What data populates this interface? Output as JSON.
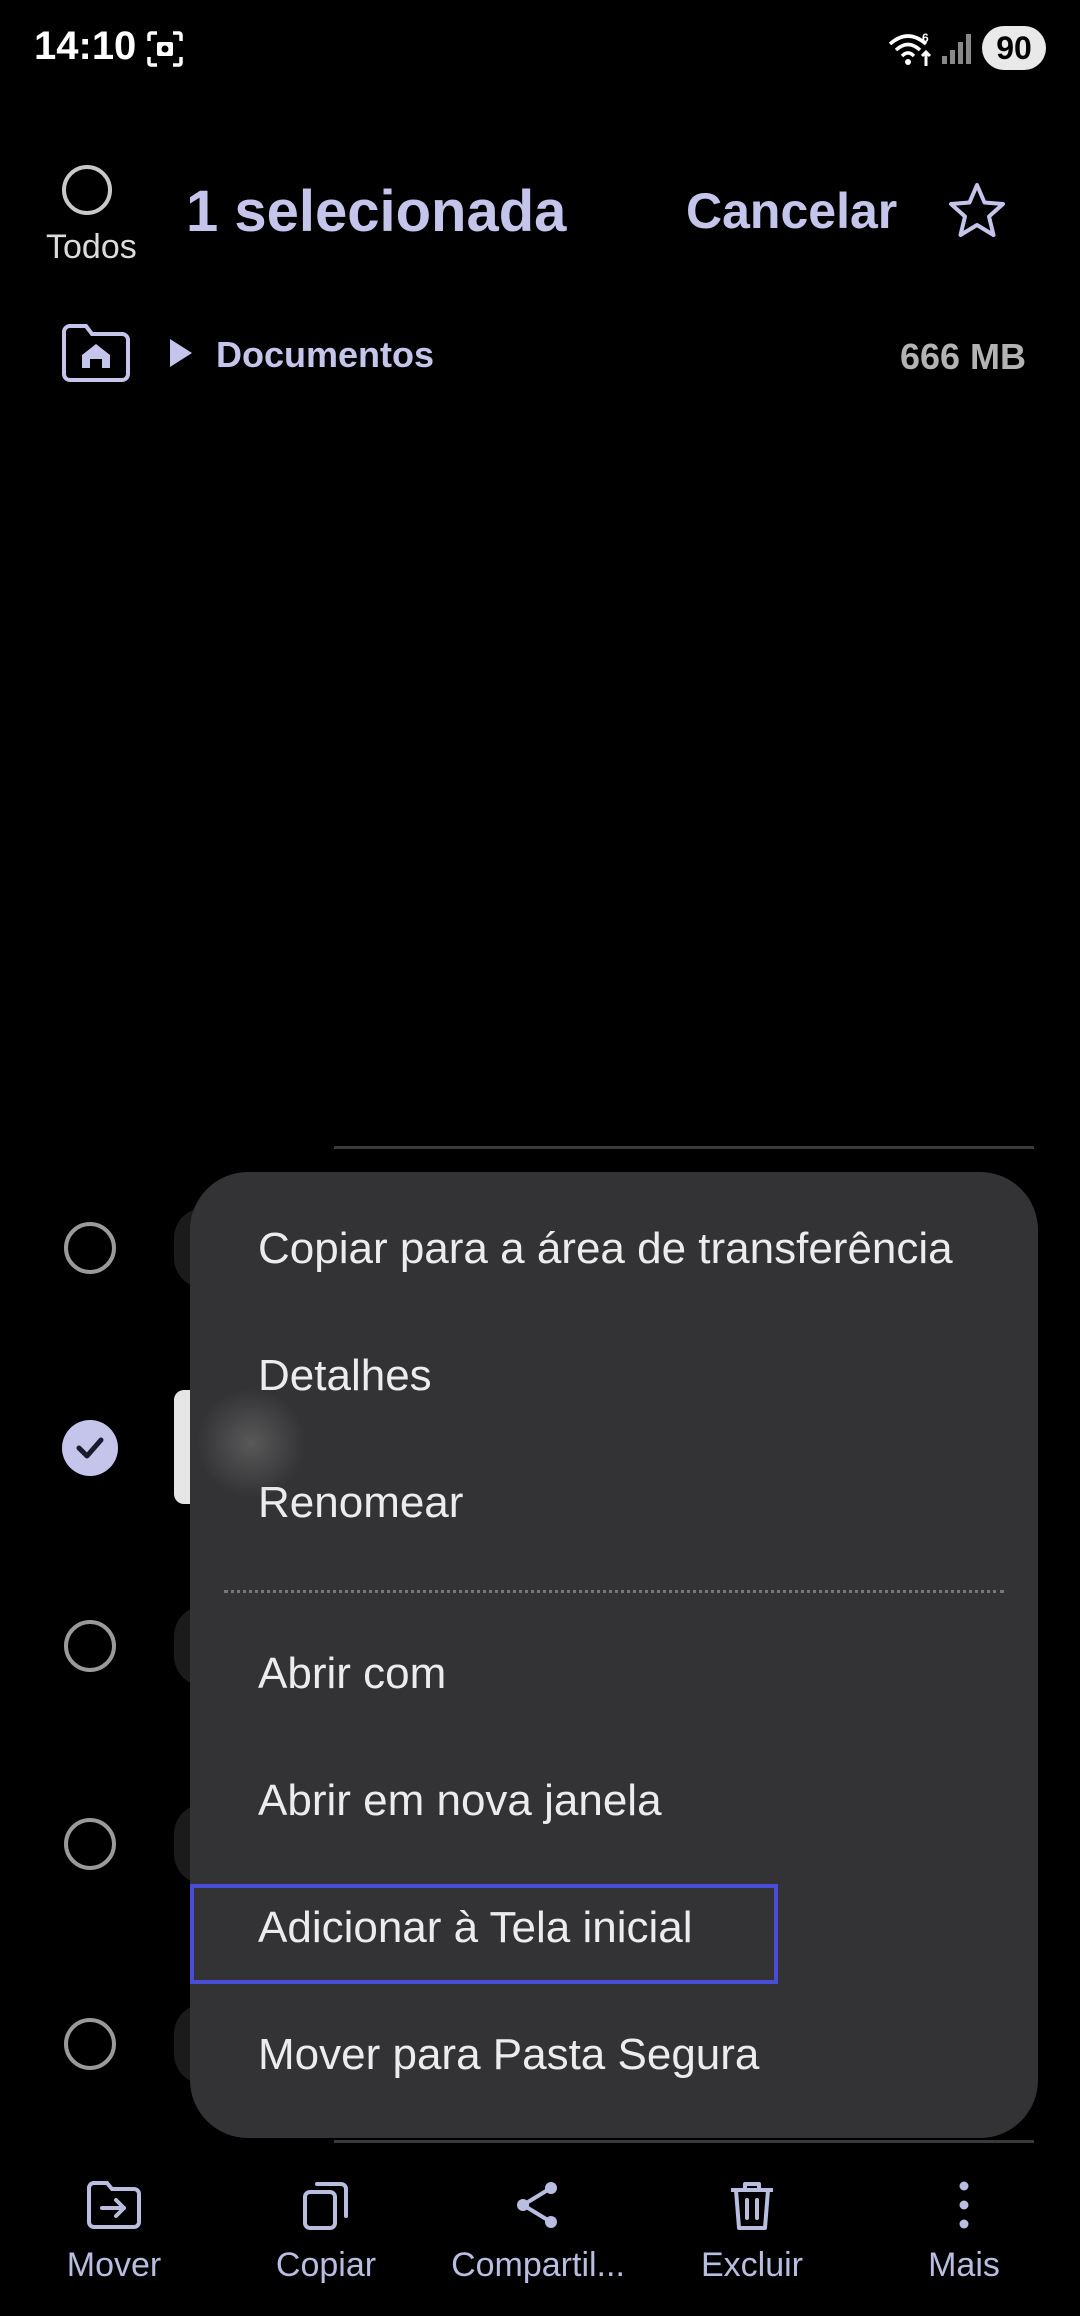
{
  "status_bar": {
    "time": "14:10",
    "battery": "90",
    "icons": [
      "screenshot-icon",
      "wifi-icon",
      "signal-icon"
    ]
  },
  "header": {
    "select_all_label": "Todos",
    "title": "1 selecionada",
    "cancel_label": "Cancelar",
    "favorite_icon": "star-icon"
  },
  "breadcrumb": {
    "home_icon": "home-icon",
    "folder": "Documentos",
    "size": "666 MB"
  },
  "list": {
    "rows": [
      {
        "selected": false
      },
      {
        "selected": true
      },
      {
        "selected": false
      },
      {
        "selected": false
      },
      {
        "selected": false
      }
    ]
  },
  "menu": {
    "items": [
      {
        "label": "Copiar para a área de transferência"
      },
      {
        "label": "Detalhes"
      },
      {
        "label": "Renomear"
      },
      {
        "label": "Abrir com"
      },
      {
        "label": "Abrir em nova janela"
      },
      {
        "label": "Adicionar à Tela inicial"
      },
      {
        "label": "Mover para Pasta Segura"
      }
    ],
    "highlighted": "Adicionar à Tela inicial"
  },
  "toolbar": {
    "items": [
      {
        "label": "Mover",
        "icon": "move-icon"
      },
      {
        "label": "Copiar",
        "icon": "copy-icon"
      },
      {
        "label": "Compartil...",
        "icon": "share-icon"
      },
      {
        "label": "Excluir",
        "icon": "trash-icon"
      },
      {
        "label": "Mais",
        "icon": "more-vertical-icon"
      }
    ]
  },
  "colors": {
    "accent": "#c5c5ec",
    "menu_background": "#333335",
    "highlight_border": "#4a4dd8"
  }
}
